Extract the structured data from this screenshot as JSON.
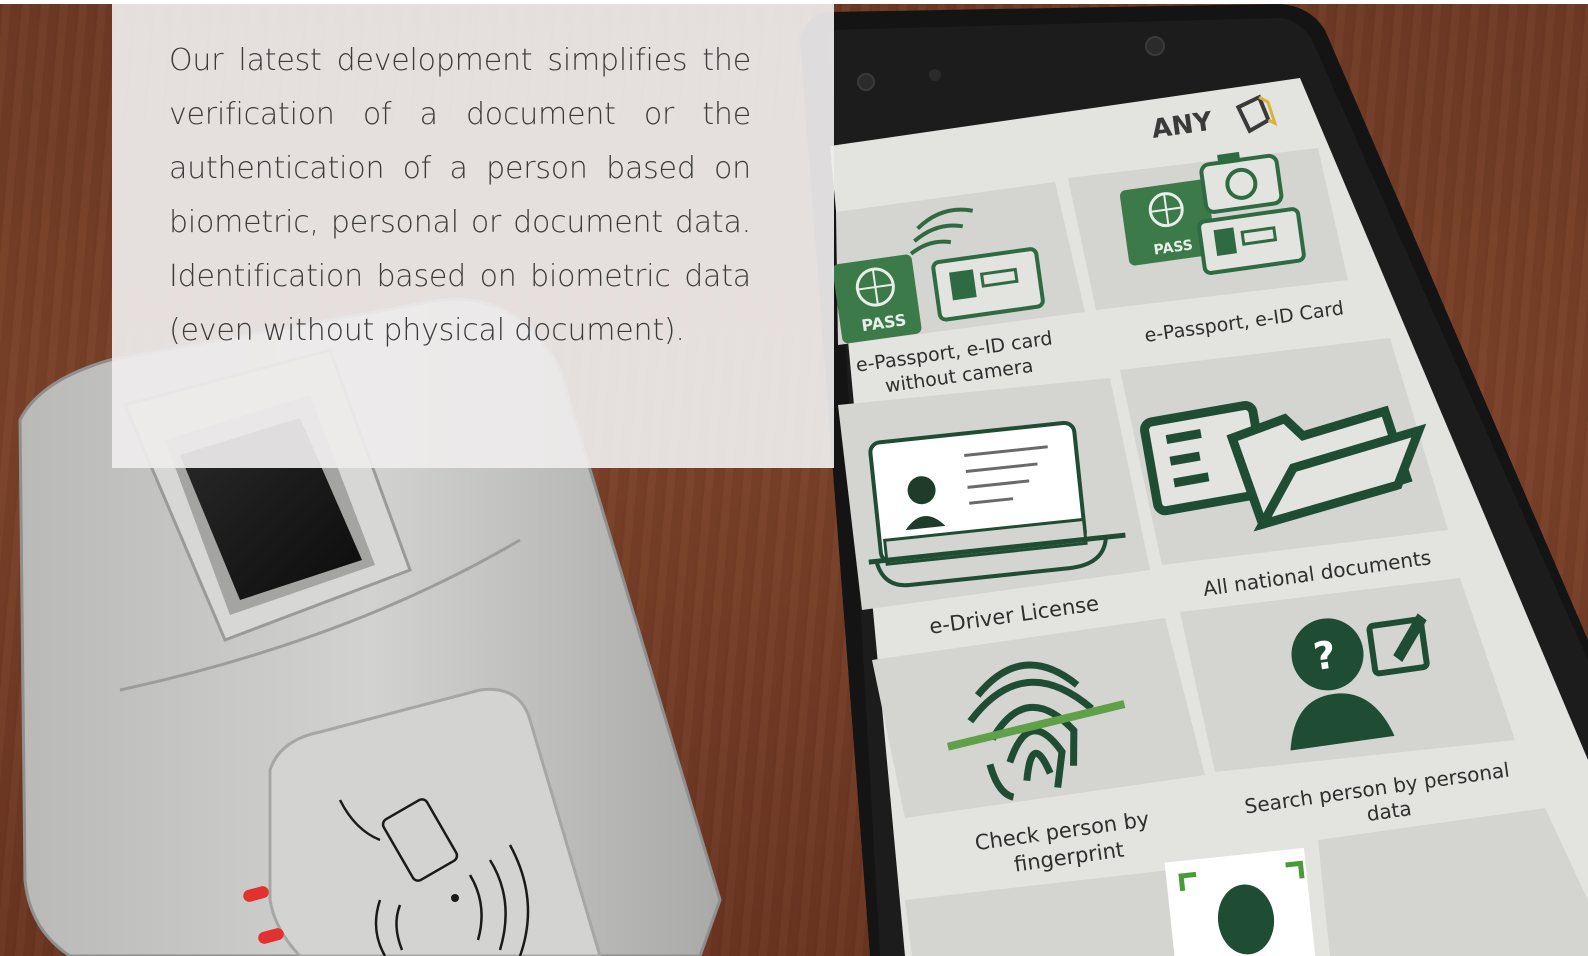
{
  "intro": {
    "paragraph": "Our latest development simplifies the verification of a document or the authentication of a person based on biometric, personal or document data. Identification based on biometric data (even without physical document)."
  },
  "phone": {
    "brand": "ANY",
    "tiles": [
      {
        "line1": "e-Passport, e-ID card",
        "line2": "without camera",
        "icon": "passport-wireless-icon"
      },
      {
        "line1": "e-Passport, e-ID Card",
        "line2": "",
        "icon": "passport-camera-icon"
      },
      {
        "line1": "e-Driver License",
        "line2": "",
        "icon": "driver-license-icon"
      },
      {
        "line1": "All national documents",
        "line2": "",
        "icon": "folder-documents-icon"
      },
      {
        "line1": "Check person by",
        "line2": "fingerprint",
        "icon": "fingerprint-icon"
      },
      {
        "line1": "Search person by personal",
        "line2": "data",
        "icon": "person-search-icon"
      }
    ],
    "pass_label": "PASS"
  },
  "colors": {
    "wood": "#743d26",
    "icon_green": "#1f5b3a",
    "pass_green": "#3d7a49",
    "screen": "#e3e3e0",
    "reader": "#c7c8c6"
  }
}
